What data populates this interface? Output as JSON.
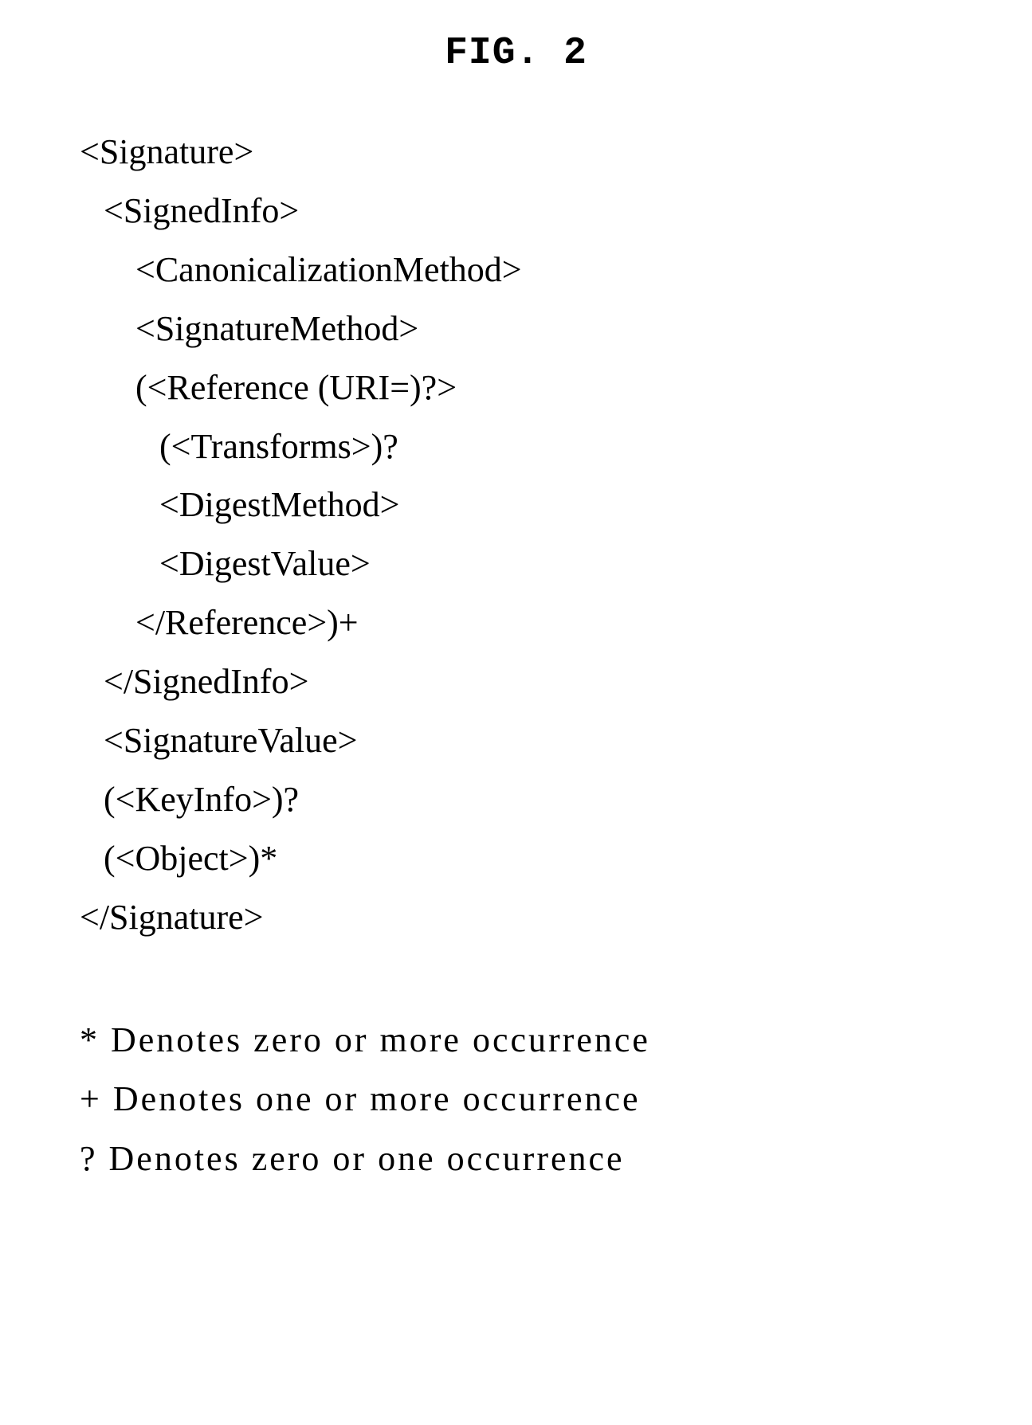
{
  "title": "FIG. 2",
  "code": {
    "l0": "<Signature>",
    "l1": "<SignedInfo>",
    "l2": "<CanonicalizationMethod>",
    "l3": "<SignatureMethod>",
    "l4": "(<Reference (URI=)?>",
    "l5": "(<Transforms>)?",
    "l6": "<DigestMethod>",
    "l7": "<DigestValue>",
    "l8": "</Reference>)+",
    "l9": "</SignedInfo>",
    "l10": "<SignatureValue>",
    "l11": "(<KeyInfo>)?",
    "l12": "(<Object>)*",
    "l13": "</Signature>"
  },
  "legend": {
    "star": "* Denotes zero or more occurrence",
    "plus": "+ Denotes one or more occurrence",
    "question": "? Denotes zero or one occurrence"
  }
}
